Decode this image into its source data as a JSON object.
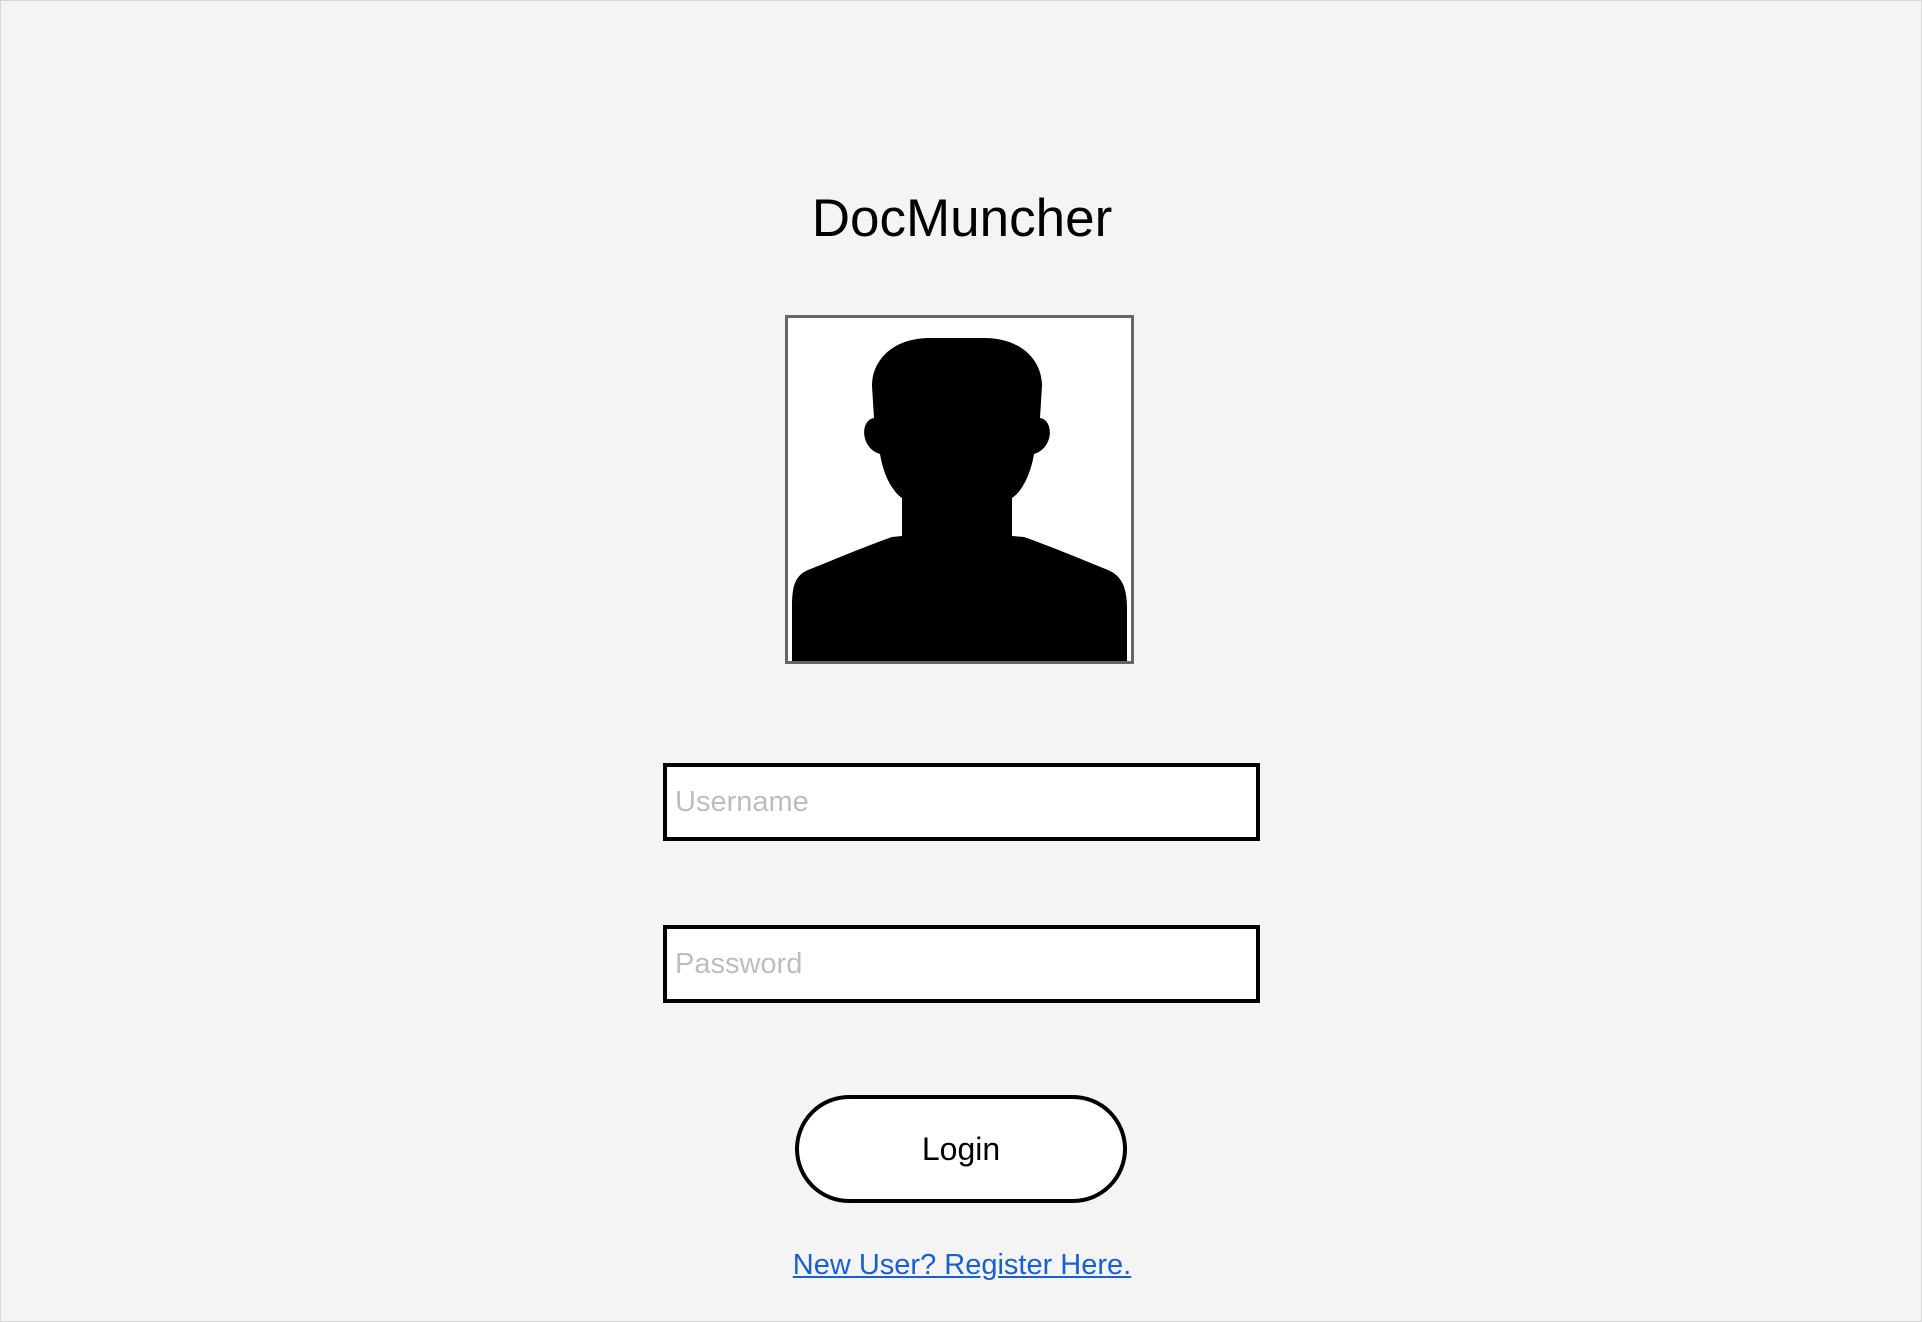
{
  "app": {
    "title": "DocMuncher"
  },
  "avatar": {
    "icon": "person-silhouette-icon"
  },
  "form": {
    "username": {
      "value": "",
      "placeholder": "Username"
    },
    "password": {
      "value": "",
      "placeholder": "Password"
    },
    "login_label": "Login",
    "register_label": "New User? Register Here."
  },
  "colors": {
    "background": "#f4f4f4",
    "link": "#1a5fd0",
    "placeholder": "#bdbdbd",
    "avatar_border": "#666666"
  }
}
